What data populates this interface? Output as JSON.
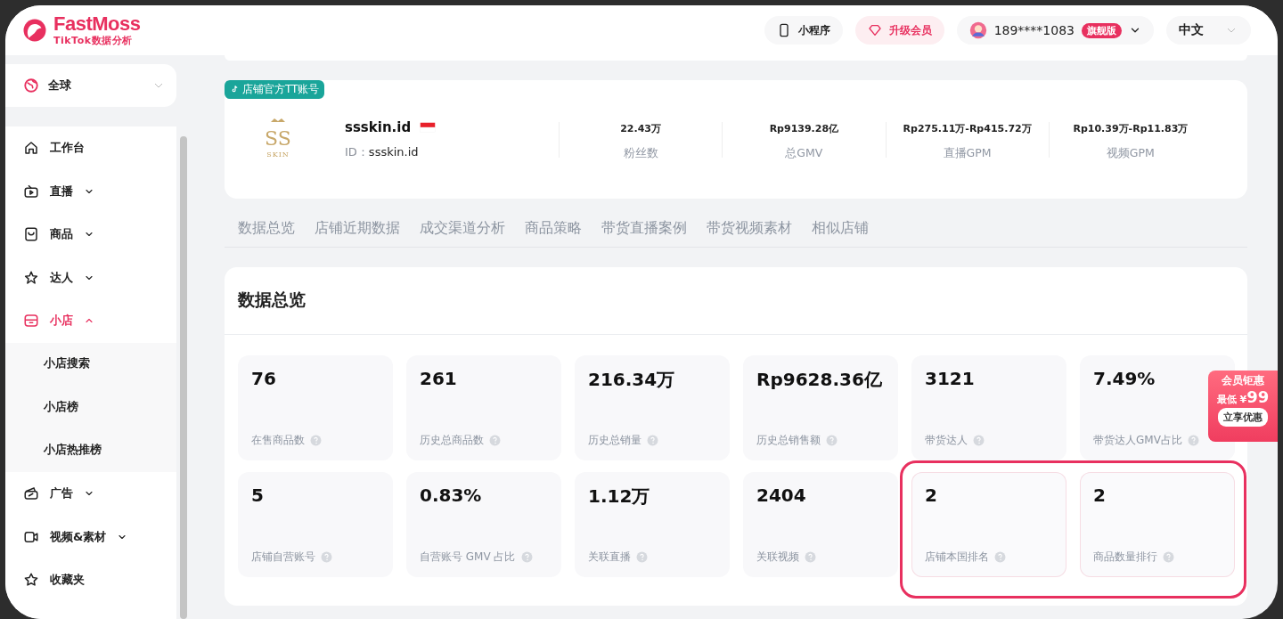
{
  "header": {
    "logo": "FastMoss",
    "logo_subtitle": "TikTok数据分析",
    "mini_program": "小程序",
    "upgrade": "升级会员",
    "user": "189****1083",
    "user_badge": "旗舰版",
    "language": "中文"
  },
  "sidebar": {
    "region": "全球",
    "items": [
      {
        "label": "工作台",
        "selected": false
      },
      {
        "label": "直播",
        "expanded": false,
        "selected": false
      },
      {
        "label": "商品",
        "expanded": false,
        "selected": false
      },
      {
        "label": "达人",
        "expanded": false,
        "selected": false
      },
      {
        "label": "小店",
        "expanded": true,
        "selected": true,
        "children": [
          {
            "label": "小店搜索"
          },
          {
            "label": "小店榜"
          },
          {
            "label": "小店热推榜"
          }
        ]
      },
      {
        "label": "广告",
        "expanded": false,
        "selected": false
      },
      {
        "label": "视频&素材",
        "expanded": false,
        "selected": false
      },
      {
        "label": "收藏夹",
        "selected": false
      }
    ]
  },
  "shop": {
    "tag": "店铺官方TT账号",
    "logo_monogram": "SS",
    "logo_text": "SKIN",
    "name": "ssskin.id",
    "id_label": "ID：",
    "id": "ssskin.id",
    "stats": [
      {
        "value": "22.43万",
        "label": "粉丝数"
      },
      {
        "value": "Rp9139.28亿",
        "label": "总GMV"
      },
      {
        "value": "Rp275.11万-Rp415.72万",
        "label": "直播GPM"
      },
      {
        "value": "Rp10.39万-Rp11.83万",
        "label": "视频GPM"
      }
    ]
  },
  "tabs": [
    {
      "label": "数据总览",
      "selected": false
    },
    {
      "label": "店铺近期数据",
      "selected": false
    },
    {
      "label": "成交渠道分析",
      "selected": false
    },
    {
      "label": "商品策略",
      "selected": false
    },
    {
      "label": "带货直播案例",
      "selected": false
    },
    {
      "label": "带货视频素材",
      "selected": false
    },
    {
      "label": "相似店铺",
      "selected": false
    }
  ],
  "overview": {
    "title": "数据总览",
    "cards": [
      {
        "value": "76",
        "label": "在售商品数",
        "highlighted": false
      },
      {
        "value": "261",
        "label": "历史总商品数",
        "highlighted": false
      },
      {
        "value": "216.34万",
        "label": "历史总销量",
        "highlighted": false
      },
      {
        "value": "Rp9628.36亿",
        "label": "历史总销售额",
        "highlighted": false
      },
      {
        "value": "3121",
        "label": "带货达人",
        "highlighted": false
      },
      {
        "value": "7.49%",
        "label": "带货达人GMV占比",
        "highlighted": false
      },
      {
        "value": "5",
        "label": "店铺自营账号",
        "highlighted": false
      },
      {
        "value": "0.83%",
        "label": "自营账号 GMV 占比",
        "highlighted": false
      },
      {
        "value": "1.12万",
        "label": "关联直播",
        "highlighted": false
      },
      {
        "value": "2404",
        "label": "关联视频",
        "highlighted": false
      },
      {
        "value": "2",
        "label": "店铺本国排名",
        "highlighted": true
      },
      {
        "value": "2",
        "label": "商品数量排行",
        "highlighted": true
      }
    ]
  },
  "promo": {
    "title": "会员钜惠",
    "price_label": "最低 ¥",
    "price": "99",
    "button": "立享优惠"
  }
}
